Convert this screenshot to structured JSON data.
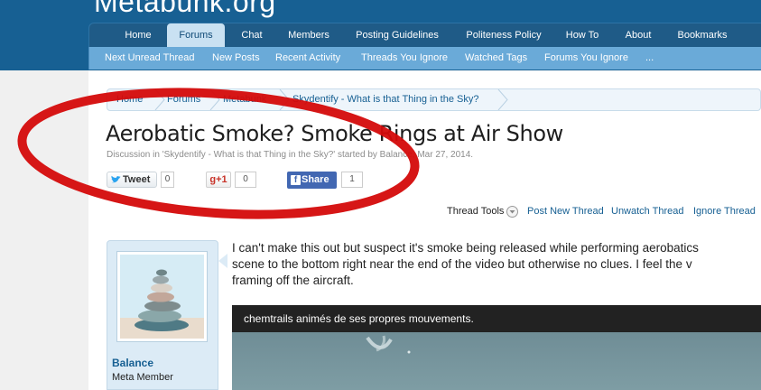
{
  "site": {
    "logo": "Metabunk.org"
  },
  "nav": {
    "tabs": [
      {
        "label": "Home"
      },
      {
        "label": "Forums"
      },
      {
        "label": "Chat"
      },
      {
        "label": "Members"
      },
      {
        "label": "Posting Guidelines"
      },
      {
        "label": "Politeness Policy"
      },
      {
        "label": "How To"
      },
      {
        "label": "About"
      },
      {
        "label": "Bookmarks"
      }
    ],
    "active_tab": "Forums",
    "sub": [
      {
        "label": "Next Unread Thread"
      },
      {
        "label": "New Posts"
      },
      {
        "label": "Recent Activity"
      },
      {
        "label": "Threads You Ignore"
      },
      {
        "label": "Watched Tags"
      },
      {
        "label": "Forums You Ignore"
      },
      {
        "label": "..."
      }
    ]
  },
  "breadcrumb": [
    {
      "label": "Home"
    },
    {
      "label": "Forums"
    },
    {
      "label": "Metabunk"
    },
    {
      "label": "Skydentify - What is that Thing in the Sky?"
    }
  ],
  "thread": {
    "title": "Aerobatic Smoke? Smoke Rings at Air Show",
    "meta": "Discussion in 'Skydentify - What is that Thing in the Sky?' started by Balance, Mar 27, 2014."
  },
  "share": {
    "tweet_label": "Tweet",
    "tweet_count": "0",
    "gplus_label": "+1",
    "gplus_count": "0",
    "fb_label": "Share",
    "fb_icon": "f",
    "fb_count": "1"
  },
  "tools": {
    "thread_tools": "Thread Tools",
    "post_new": "Post New Thread",
    "unwatch": "Unwatch Thread",
    "ignore": "Ignore Thread"
  },
  "post": {
    "username": "Balance",
    "user_title": "Meta Member",
    "lines": [
      "I can't make this out but suspect it's smoke being released while performing aerobatics",
      "scene to the bottom right near the end of the video but otherwise no clues. I feel the v",
      "framing off the aircraft."
    ],
    "video_title": "chemtrails animés de ses propres mouvements."
  },
  "colors": {
    "header": "#176093",
    "subnav": "#6aaad8",
    "active_tab": "#c9e1f2",
    "link": "#176093",
    "annotation": "#d40a0a",
    "facebook": "#4267b2"
  }
}
